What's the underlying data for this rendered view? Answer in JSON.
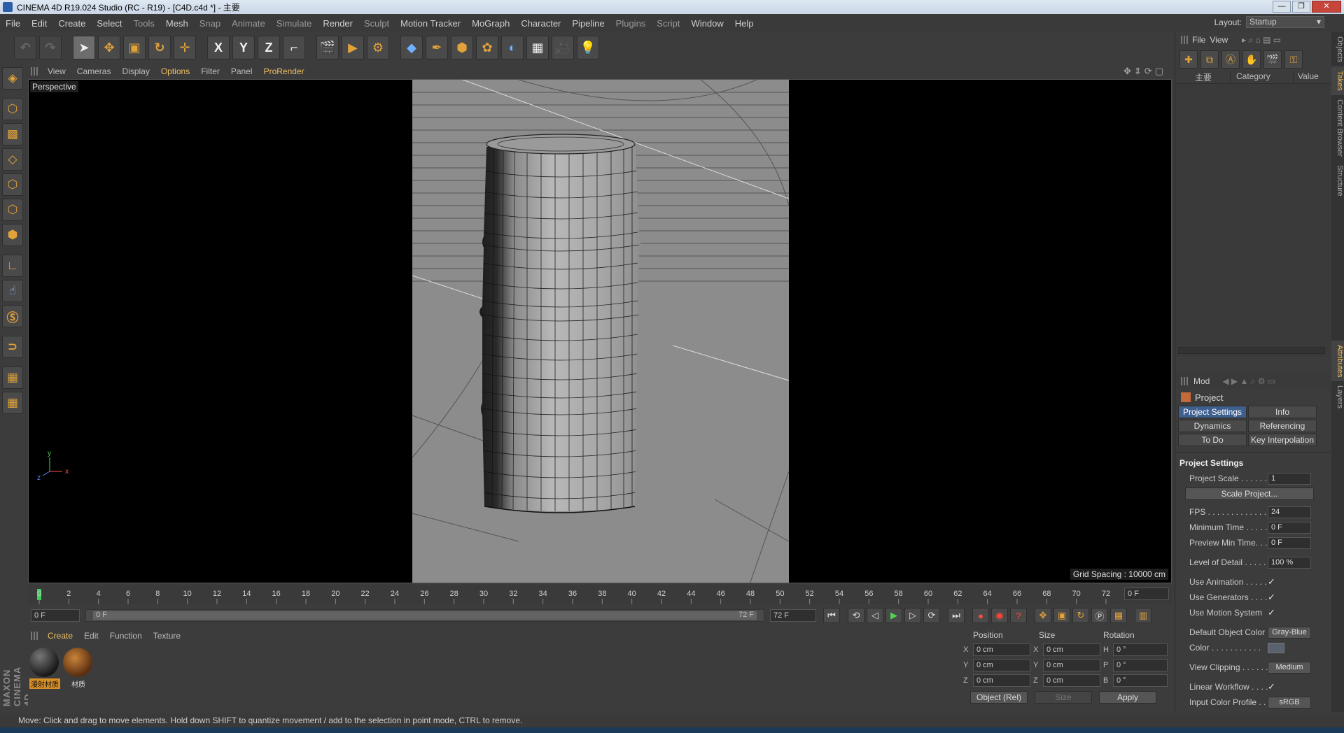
{
  "window": {
    "title": "CINEMA 4D R19.024 Studio (RC - R19) - [C4D.c4d *] - 主要",
    "min": "—",
    "max": "❐",
    "close": "✕"
  },
  "menu": {
    "items": [
      "File",
      "Edit",
      "Create",
      "Select",
      "Tools",
      "Mesh",
      "Snap",
      "Animate",
      "Simulate",
      "Render",
      "Sculpt",
      "Motion Tracker",
      "MoGraph",
      "Character",
      "Pipeline",
      "Plugins",
      "Script",
      "Window",
      "Help"
    ],
    "layout_label": "Layout:",
    "layout_value": "Startup"
  },
  "toolbar": {
    "icons": [
      "undo-icon",
      "redo-icon",
      "select-arrow-icon",
      "move-icon",
      "scale-icon",
      "rotate-icon",
      "transform-icon",
      "x-axis-icon",
      "y-axis-icon",
      "z-axis-icon",
      "coordinate-system-icon",
      "render-view-icon",
      "render-picture-viewer-icon",
      "render-settings-icon",
      "cube-icon",
      "pen-icon",
      "subdivision-icon",
      "cloner-icon",
      "deformer-icon",
      "floor-icon",
      "camera-icon",
      "light-icon"
    ],
    "x_label": "X",
    "y_label": "Y",
    "z_label": "Z"
  },
  "viewport": {
    "menu": [
      "View",
      "Cameras",
      "Display",
      "Options",
      "Filter",
      "Panel",
      "ProRender"
    ],
    "active_menu": "Options",
    "label": "Perspective",
    "grid_spacing": "Grid Spacing : 10000 cm",
    "axis": {
      "y": "y",
      "z": "z",
      "x": "x"
    }
  },
  "timeline": {
    "ticks": [
      "0",
      "2",
      "4",
      "6",
      "8",
      "10",
      "12",
      "14",
      "16",
      "18",
      "20",
      "22",
      "24",
      "26",
      "28",
      "30",
      "32",
      "34",
      "36",
      "38",
      "40",
      "42",
      "44",
      "46",
      "48",
      "50",
      "52",
      "54",
      "56",
      "58",
      "60",
      "62",
      "64",
      "66",
      "68",
      "70",
      "72"
    ],
    "current_frame": "0 F",
    "start_field": "0 F",
    "slider_left": "0 F",
    "slider_right": "72 F",
    "end_field": "72 F"
  },
  "materials": {
    "menu": [
      "Create",
      "Edit",
      "Function",
      "Texture"
    ],
    "active_menu": "Create",
    "items": [
      {
        "name": "漫射材质",
        "color": "#3a3a3a",
        "selected": true
      },
      {
        "name": "材质",
        "color": "#8a5a2a",
        "selected": false
      }
    ]
  },
  "coords": {
    "headers": [
      "Position",
      "Size",
      "Rotation"
    ],
    "rows": [
      {
        "pl": "X",
        "pv": "0 cm",
        "sl": "X",
        "sv": "0 cm",
        "rl": "H",
        "rv": "0 °"
      },
      {
        "pl": "Y",
        "pv": "0 cm",
        "sl": "Y",
        "sv": "0 cm",
        "rl": "P",
        "rv": "0 °"
      },
      {
        "pl": "Z",
        "pv": "0 cm",
        "sl": "Z",
        "sv": "0 cm",
        "rl": "B",
        "rv": "0 °"
      }
    ],
    "mode": "Object (Rel)",
    "size_mode": "Size",
    "apply": "Apply"
  },
  "status": "Move: Click and drag to move elements. Hold down SHIFT to quantize movement / add to the selection in point mode, CTRL to remove.",
  "objects_panel": {
    "menu": [
      "File",
      "View"
    ],
    "columns": [
      "主要",
      "Category",
      "Value"
    ]
  },
  "attributes": {
    "menu_label": "Mod",
    "title": "Project",
    "tabs": [
      "Project Settings",
      "Info",
      "Dynamics",
      "Referencing",
      "To Do",
      "Key Interpolation"
    ],
    "active_tab": "Project Settings",
    "section": "Project Settings",
    "rows": [
      {
        "label": "Project Scale . . . . . . .",
        "value": "1",
        "kind": "field"
      },
      {
        "label": "FPS . . . . . . . . . . . . . .",
        "value": "24",
        "kind": "field"
      },
      {
        "label": "Minimum Time . . . . .",
        "value": "0 F",
        "kind": "field"
      },
      {
        "label": "Preview Min Time. . .",
        "value": "0 F",
        "kind": "field"
      },
      {
        "label": "Level of Detail . . . . .",
        "value": "100 %",
        "kind": "field"
      },
      {
        "label": "Use Animation . . . . . .",
        "value": "✓",
        "kind": "check"
      },
      {
        "label": "Use Generators . . . . .",
        "value": "✓",
        "kind": "check"
      },
      {
        "label": "Use Motion System",
        "value": "✓",
        "kind": "check"
      },
      {
        "label": "Default Object Color",
        "value": "Gray-Blue",
        "kind": "button"
      },
      {
        "label": "Color . . . . . . . . . . .",
        "value": "",
        "kind": "swatch"
      },
      {
        "label": "View Clipping . . . . . .",
        "value": "Medium",
        "kind": "button"
      },
      {
        "label": "Linear Workflow . . . .",
        "value": "✓",
        "kind": "check"
      },
      {
        "label": "Input Color Profile . .",
        "value": "sRGB",
        "kind": "button"
      }
    ],
    "scale_button": "Scale Project..."
  },
  "side_tabs": [
    "Objects",
    "Takes",
    "Content Browser",
    "Structure",
    "Attributes",
    "Layers"
  ],
  "side_tab_active": [
    "Takes",
    "Attributes"
  ]
}
